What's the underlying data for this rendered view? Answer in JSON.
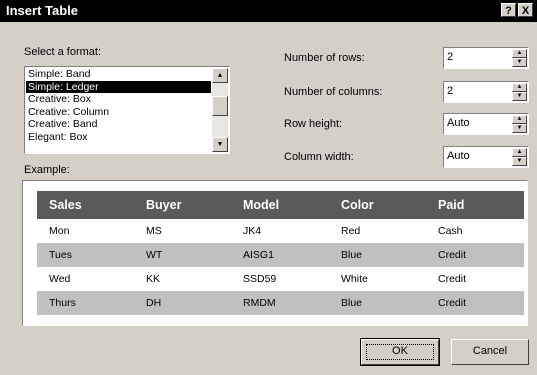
{
  "window": {
    "title": "Insert Table",
    "help_label": "?",
    "close_label": "X"
  },
  "format": {
    "label": "Select a format:",
    "items": [
      {
        "label": "Simple: Band"
      },
      {
        "label": "Simple: Ledger",
        "selected": true
      },
      {
        "label": "Creative: Box"
      },
      {
        "label": "Creative: Column"
      },
      {
        "label": "Creative: Band"
      },
      {
        "label": "Elegant: Box"
      }
    ]
  },
  "fields": {
    "rows": {
      "label": "Number of rows:",
      "value": "2"
    },
    "columns": {
      "label": "Number of columns:",
      "value": "2"
    },
    "row_height": {
      "label": "Row height:",
      "value": "Auto"
    },
    "column_width": {
      "label": "Column width:",
      "value": "Auto"
    }
  },
  "example": {
    "label": "Example:",
    "headers": [
      "Sales",
      "Buyer",
      "Model",
      "Color",
      "Paid"
    ],
    "rows": [
      [
        "Mon",
        "MS",
        "JK4",
        "Red",
        "Cash"
      ],
      [
        "Tues",
        "WT",
        "AISG1",
        "Blue",
        "Credit"
      ],
      [
        "Wed",
        "KK",
        "SSD59",
        "White",
        "Credit"
      ],
      [
        "Thurs",
        "DH",
        "RMDM",
        "Blue",
        "Credit"
      ]
    ]
  },
  "buttons": {
    "ok": "OK",
    "cancel": "Cancel"
  },
  "colors": {
    "title_bar": "#000000",
    "header_fill": "#5a5a5a",
    "band_fill": "#c0c0c0",
    "dialog_bg": "#d4d0c8"
  }
}
